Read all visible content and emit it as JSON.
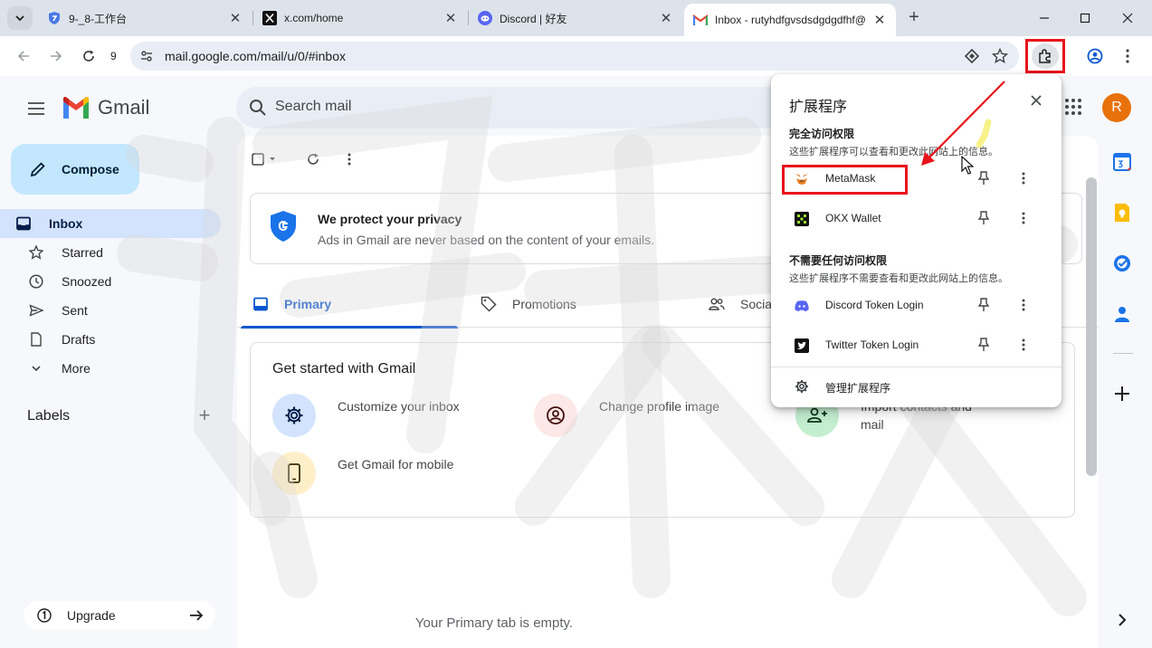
{
  "browser": {
    "tabs": [
      {
        "title": "9-_8-工作台",
        "favicon": "shield-icon"
      },
      {
        "title": "x.com/home",
        "favicon": "x-logo-icon"
      },
      {
        "title": "Discord | 好友",
        "favicon": "discord-icon"
      },
      {
        "title": "Inbox - rutyhdfgvsdsdgdgdfhf@",
        "favicon": "gmail-icon",
        "active": true
      }
    ],
    "reload_count": "9",
    "url": "mail.google.com/mail/u/0/#inbox"
  },
  "gmail": {
    "logo_text": "Gmail",
    "search_placeholder": "Search mail",
    "avatar_letter": "R",
    "compose_label": "Compose",
    "nav": [
      {
        "label": "Inbox",
        "icon": "inbox-icon",
        "selected": true
      },
      {
        "label": "Starred",
        "icon": "star-icon"
      },
      {
        "label": "Snoozed",
        "icon": "clock-icon"
      },
      {
        "label": "Sent",
        "icon": "send-icon"
      },
      {
        "label": "Drafts",
        "icon": "draft-icon"
      },
      {
        "label": "More",
        "icon": "chevron-down-icon"
      }
    ],
    "labels_heading": "Labels",
    "upgrade_label": "Upgrade",
    "privacy": {
      "title": "We protect your privacy",
      "subtitle": "Ads in Gmail are never based on the content of your emails."
    },
    "inbox_tabs": [
      {
        "label": "Primary",
        "icon": "inbox-tab-icon",
        "selected": true
      },
      {
        "label": "Promotions",
        "icon": "tag-icon"
      },
      {
        "label": "Socia",
        "icon": "people-icon"
      }
    ],
    "get_started": {
      "title": "Get started with Gmail",
      "items": [
        {
          "text": "Customize your inbox",
          "icon": "settings-icon"
        },
        {
          "text": "Change profile image",
          "icon": "profile-icon"
        },
        {
          "text": "Import contacts and mail",
          "icon": "add-contact-icon"
        },
        {
          "text": "Get Gmail for mobile",
          "icon": "phone-icon"
        }
      ]
    },
    "empty_text": "Your Primary tab is empty."
  },
  "extensions_popup": {
    "title": "扩展程序",
    "full_access_heading": "完全访问权限",
    "full_access_desc": "这些扩展程序可以查看和更改此网站上的信息。",
    "full_access": [
      {
        "name": "MetaMask",
        "icon": "metamask-icon"
      },
      {
        "name": "OKX Wallet",
        "icon": "okx-icon"
      }
    ],
    "no_access_heading": "不需要任何访问权限",
    "no_access_desc": "这些扩展程序不需要查看和更改此网站上的信息。",
    "no_access": [
      {
        "name": "Discord Token Login",
        "icon": "discord-icon"
      },
      {
        "name": "Twitter Token Login",
        "icon": "twitter-icon"
      }
    ],
    "manage_label": "管理扩展程序"
  },
  "colors": {
    "highlight": "#e8141b",
    "gmail_accent": "#0b57d0",
    "compose_bg": "#c2e7ff",
    "avatar_bg": "#e8710a"
  }
}
